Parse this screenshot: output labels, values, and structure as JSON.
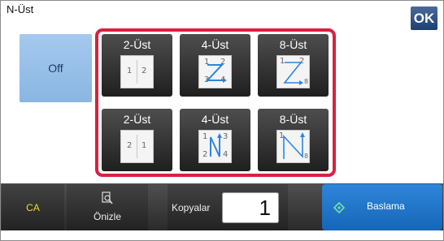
{
  "header": {
    "title": "N-Üst",
    "ok_label": "OK"
  },
  "off_label": "Off",
  "options": [
    {
      "label": "2-Üst",
      "icon": "2up-left-to-right-icon",
      "digits": [
        "1",
        "2"
      ]
    },
    {
      "label": "4-Üst",
      "icon": "4up-z-order-icon",
      "digits": [
        "1",
        "2",
        "3",
        "4"
      ]
    },
    {
      "label": "8-Üst",
      "icon": "8up-z-order-icon",
      "digits": [
        "1",
        "2",
        "8"
      ]
    },
    {
      "label": "2-Üst",
      "icon": "2up-right-to-left-icon",
      "digits": [
        "2",
        "1"
      ]
    },
    {
      "label": "4-Üst",
      "icon": "4up-n-order-icon",
      "digits": [
        "1",
        "3",
        "2",
        "4"
      ]
    },
    {
      "label": "8-Üst",
      "icon": "8up-n-order-icon",
      "digits": [
        "1",
        "8"
      ]
    }
  ],
  "bottom": {
    "ca_label": "CA",
    "preview_label": "Önizle",
    "copies_label": "Kopyalar",
    "copies_value": "1",
    "start_label": "Baslama"
  },
  "colors": {
    "accent_red": "#d92040",
    "ok_blue": "#1e3f73",
    "off_blue": "#8ab6e2",
    "start_blue": "#1566b7",
    "ca_yellow": "#f2d93a"
  }
}
